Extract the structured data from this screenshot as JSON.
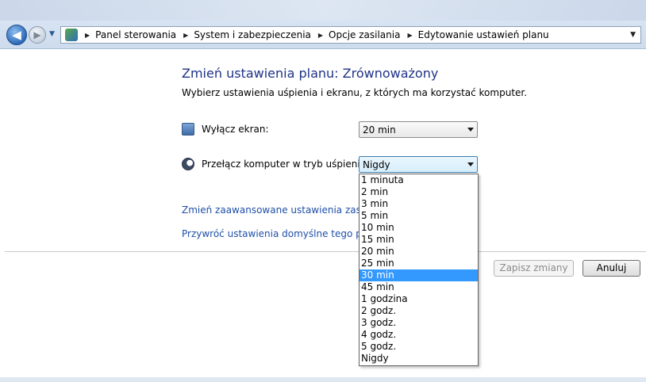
{
  "breadcrumb": [
    "Panel sterowania",
    "System i zabezpieczenia",
    "Opcje zasilania",
    "Edytowanie ustawień planu"
  ],
  "icons": {
    "back": "back-arrow-icon",
    "forward": "forward-arrow-icon",
    "address": "control-panel-icon"
  },
  "main": {
    "title": "Zmień ustawienia planu: Zrównoważony",
    "subtitle": "Wybierz ustawienia uśpienia i ekranu, z których ma korzystać komputer.",
    "display_label": "Wyłącz ekran:",
    "display_value": "20 min",
    "sleep_label": "Przełącz komputer w tryb uśpienia:",
    "sleep_value": "Nigdy",
    "link_advanced": "Zmień zaawansowane ustawienia zasilania",
    "link_restore": "Przywróć ustawienia domyślne tego planu",
    "save_label": "Zapisz zmiany",
    "cancel_label": "Anuluj"
  },
  "dropdown": {
    "options": [
      "1 minuta",
      "2 min",
      "3 min",
      "5 min",
      "10 min",
      "15 min",
      "20 min",
      "25 min",
      "30 min",
      "45 min",
      "1 godzina",
      "2 godz.",
      "3 godz.",
      "4 godz.",
      "5 godz.",
      "Nigdy"
    ],
    "highlighted_index": 8
  }
}
